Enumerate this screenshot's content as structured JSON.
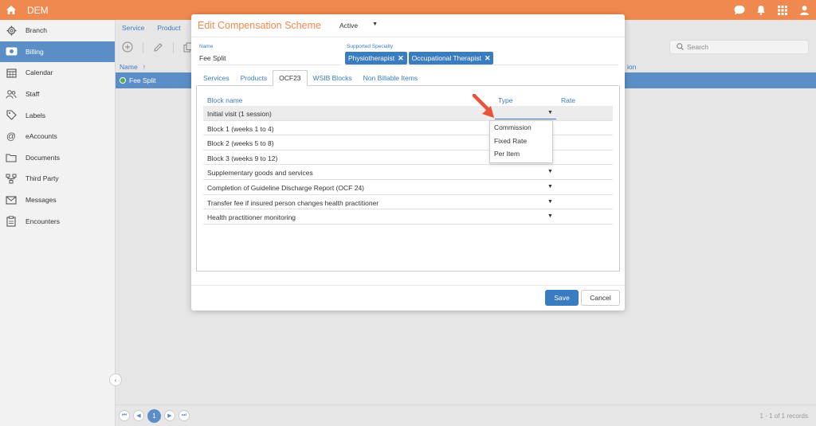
{
  "topbar": {
    "title": "DEM",
    "icons": [
      "home-icon",
      "chat-icon",
      "bell-icon",
      "apps-grid-icon",
      "user-icon"
    ],
    "color": "#f0894f"
  },
  "sidebar": {
    "items": [
      {
        "label": "Branch",
        "icon": "gear-icon"
      },
      {
        "label": "Billing",
        "icon": "money-icon",
        "active": true
      },
      {
        "label": "Calendar",
        "icon": "calendar-icon"
      },
      {
        "label": "Staff",
        "icon": "staff-icon"
      },
      {
        "label": "Labels",
        "icon": "tag-icon"
      },
      {
        "label": "eAccounts",
        "icon": "at-icon"
      },
      {
        "label": "Documents",
        "icon": "folder-icon"
      },
      {
        "label": "Third Party",
        "icon": "network-icon"
      },
      {
        "label": "Messages",
        "icon": "envelope-icon"
      },
      {
        "label": "Encounters",
        "icon": "clipboard-icon"
      }
    ]
  },
  "background": {
    "tabs": [
      "Service",
      "Product"
    ],
    "search_placeholder": "Search",
    "header": {
      "name": "Name",
      "sort_indicator": "↑",
      "col2": "ion"
    },
    "row": {
      "name": "Fee Split"
    },
    "pager": {
      "current": "1",
      "records": "1 - 1 of 1 records"
    }
  },
  "modal": {
    "title": "Edit Compensation Scheme",
    "status": "Active",
    "name_label": "Name",
    "name_value": "Fee Split",
    "specialty_label": "Supported Specialty",
    "specialties": [
      "Physiotherapist",
      "Occupational Therapist"
    ],
    "tabs": [
      "Services",
      "Products",
      "OCF23",
      "WSIB Blocks",
      "Non Billable Items"
    ],
    "active_tab": "OCF23",
    "grid": {
      "headers": {
        "block_name": "Block name",
        "type": "Type",
        "rate": "Rate"
      },
      "rows": [
        "Initial visit (1 session)",
        "Block 1 (weeks 1 to 4)",
        "Block 2 (weeks 5 to 8)",
        "Block 3 (weeks 9 to 12)",
        "Supplementary goods and services",
        "Completion of Guideline Discharge Report (OCF 24)",
        "Transfer fee if insured person changes health practitioner",
        "Health practitioner monitoring"
      ]
    },
    "type_options": [
      "Commission",
      "Fixed Rate",
      "Per Item"
    ],
    "save_label": "Save",
    "cancel_label": "Cancel",
    "accent": "#3a7cc0",
    "arrow_color": "#e8533a"
  }
}
